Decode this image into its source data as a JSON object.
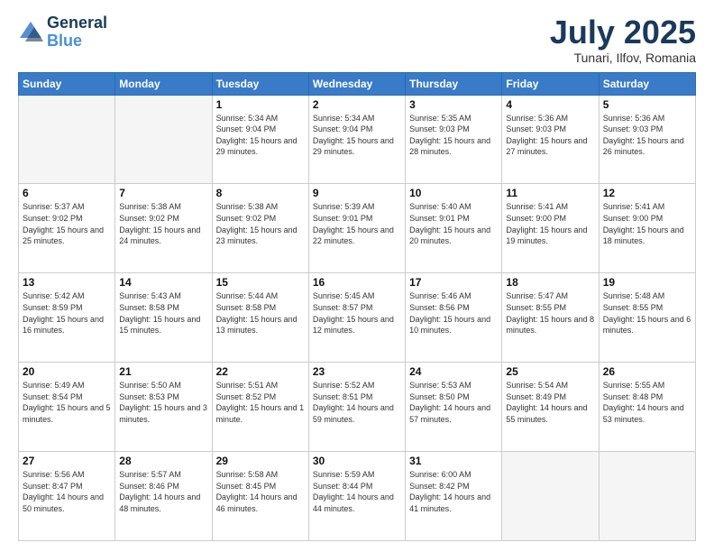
{
  "header": {
    "logo_line1": "General",
    "logo_line2": "Blue",
    "month_title": "July 2025",
    "location": "Tunari, Ilfov, Romania"
  },
  "weekdays": [
    "Sunday",
    "Monday",
    "Tuesday",
    "Wednesday",
    "Thursday",
    "Friday",
    "Saturday"
  ],
  "weeks": [
    [
      {
        "day": "",
        "sunrise": "",
        "sunset": "",
        "daylight": ""
      },
      {
        "day": "",
        "sunrise": "",
        "sunset": "",
        "daylight": ""
      },
      {
        "day": "1",
        "sunrise": "Sunrise: 5:34 AM",
        "sunset": "Sunset: 9:04 PM",
        "daylight": "Daylight: 15 hours and 29 minutes."
      },
      {
        "day": "2",
        "sunrise": "Sunrise: 5:34 AM",
        "sunset": "Sunset: 9:04 PM",
        "daylight": "Daylight: 15 hours and 29 minutes."
      },
      {
        "day": "3",
        "sunrise": "Sunrise: 5:35 AM",
        "sunset": "Sunset: 9:03 PM",
        "daylight": "Daylight: 15 hours and 28 minutes."
      },
      {
        "day": "4",
        "sunrise": "Sunrise: 5:36 AM",
        "sunset": "Sunset: 9:03 PM",
        "daylight": "Daylight: 15 hours and 27 minutes."
      },
      {
        "day": "5",
        "sunrise": "Sunrise: 5:36 AM",
        "sunset": "Sunset: 9:03 PM",
        "daylight": "Daylight: 15 hours and 26 minutes."
      }
    ],
    [
      {
        "day": "6",
        "sunrise": "Sunrise: 5:37 AM",
        "sunset": "Sunset: 9:02 PM",
        "daylight": "Daylight: 15 hours and 25 minutes."
      },
      {
        "day": "7",
        "sunrise": "Sunrise: 5:38 AM",
        "sunset": "Sunset: 9:02 PM",
        "daylight": "Daylight: 15 hours and 24 minutes."
      },
      {
        "day": "8",
        "sunrise": "Sunrise: 5:38 AM",
        "sunset": "Sunset: 9:02 PM",
        "daylight": "Daylight: 15 hours and 23 minutes."
      },
      {
        "day": "9",
        "sunrise": "Sunrise: 5:39 AM",
        "sunset": "Sunset: 9:01 PM",
        "daylight": "Daylight: 15 hours and 22 minutes."
      },
      {
        "day": "10",
        "sunrise": "Sunrise: 5:40 AM",
        "sunset": "Sunset: 9:01 PM",
        "daylight": "Daylight: 15 hours and 20 minutes."
      },
      {
        "day": "11",
        "sunrise": "Sunrise: 5:41 AM",
        "sunset": "Sunset: 9:00 PM",
        "daylight": "Daylight: 15 hours and 19 minutes."
      },
      {
        "day": "12",
        "sunrise": "Sunrise: 5:41 AM",
        "sunset": "Sunset: 9:00 PM",
        "daylight": "Daylight: 15 hours and 18 minutes."
      }
    ],
    [
      {
        "day": "13",
        "sunrise": "Sunrise: 5:42 AM",
        "sunset": "Sunset: 8:59 PM",
        "daylight": "Daylight: 15 hours and 16 minutes."
      },
      {
        "day": "14",
        "sunrise": "Sunrise: 5:43 AM",
        "sunset": "Sunset: 8:58 PM",
        "daylight": "Daylight: 15 hours and 15 minutes."
      },
      {
        "day": "15",
        "sunrise": "Sunrise: 5:44 AM",
        "sunset": "Sunset: 8:58 PM",
        "daylight": "Daylight: 15 hours and 13 minutes."
      },
      {
        "day": "16",
        "sunrise": "Sunrise: 5:45 AM",
        "sunset": "Sunset: 8:57 PM",
        "daylight": "Daylight: 15 hours and 12 minutes."
      },
      {
        "day": "17",
        "sunrise": "Sunrise: 5:46 AM",
        "sunset": "Sunset: 8:56 PM",
        "daylight": "Daylight: 15 hours and 10 minutes."
      },
      {
        "day": "18",
        "sunrise": "Sunrise: 5:47 AM",
        "sunset": "Sunset: 8:55 PM",
        "daylight": "Daylight: 15 hours and 8 minutes."
      },
      {
        "day": "19",
        "sunrise": "Sunrise: 5:48 AM",
        "sunset": "Sunset: 8:55 PM",
        "daylight": "Daylight: 15 hours and 6 minutes."
      }
    ],
    [
      {
        "day": "20",
        "sunrise": "Sunrise: 5:49 AM",
        "sunset": "Sunset: 8:54 PM",
        "daylight": "Daylight: 15 hours and 5 minutes."
      },
      {
        "day": "21",
        "sunrise": "Sunrise: 5:50 AM",
        "sunset": "Sunset: 8:53 PM",
        "daylight": "Daylight: 15 hours and 3 minutes."
      },
      {
        "day": "22",
        "sunrise": "Sunrise: 5:51 AM",
        "sunset": "Sunset: 8:52 PM",
        "daylight": "Daylight: 15 hours and 1 minute."
      },
      {
        "day": "23",
        "sunrise": "Sunrise: 5:52 AM",
        "sunset": "Sunset: 8:51 PM",
        "daylight": "Daylight: 14 hours and 59 minutes."
      },
      {
        "day": "24",
        "sunrise": "Sunrise: 5:53 AM",
        "sunset": "Sunset: 8:50 PM",
        "daylight": "Daylight: 14 hours and 57 minutes."
      },
      {
        "day": "25",
        "sunrise": "Sunrise: 5:54 AM",
        "sunset": "Sunset: 8:49 PM",
        "daylight": "Daylight: 14 hours and 55 minutes."
      },
      {
        "day": "26",
        "sunrise": "Sunrise: 5:55 AM",
        "sunset": "Sunset: 8:48 PM",
        "daylight": "Daylight: 14 hours and 53 minutes."
      }
    ],
    [
      {
        "day": "27",
        "sunrise": "Sunrise: 5:56 AM",
        "sunset": "Sunset: 8:47 PM",
        "daylight": "Daylight: 14 hours and 50 minutes."
      },
      {
        "day": "28",
        "sunrise": "Sunrise: 5:57 AM",
        "sunset": "Sunset: 8:46 PM",
        "daylight": "Daylight: 14 hours and 48 minutes."
      },
      {
        "day": "29",
        "sunrise": "Sunrise: 5:58 AM",
        "sunset": "Sunset: 8:45 PM",
        "daylight": "Daylight: 14 hours and 46 minutes."
      },
      {
        "day": "30",
        "sunrise": "Sunrise: 5:59 AM",
        "sunset": "Sunset: 8:44 PM",
        "daylight": "Daylight: 14 hours and 44 minutes."
      },
      {
        "day": "31",
        "sunrise": "Sunrise: 6:00 AM",
        "sunset": "Sunset: 8:42 PM",
        "daylight": "Daylight: 14 hours and 41 minutes."
      },
      {
        "day": "",
        "sunrise": "",
        "sunset": "",
        "daylight": ""
      },
      {
        "day": "",
        "sunrise": "",
        "sunset": "",
        "daylight": ""
      }
    ]
  ]
}
